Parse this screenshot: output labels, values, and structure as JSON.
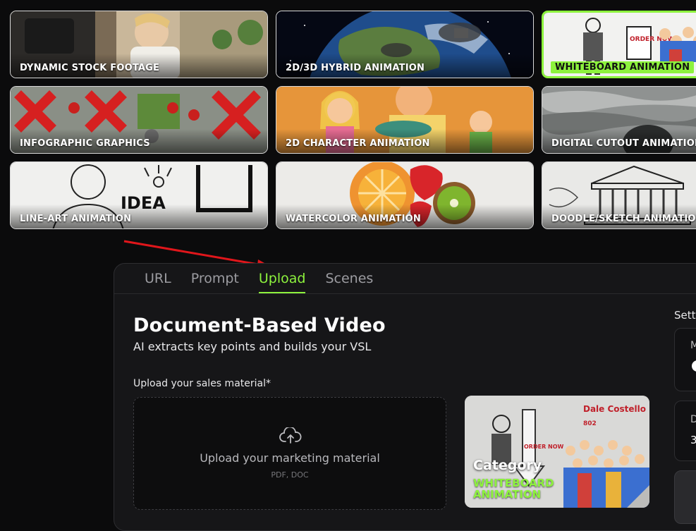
{
  "styles": [
    {
      "label": "DYNAMIC STOCK FOOTAGE",
      "selected": false
    },
    {
      "label": "2D/3D HYBRID ANIMATION",
      "selected": false
    },
    {
      "label": "WHITEBOARD ANIMATION",
      "selected": true
    },
    {
      "label": "INFOGRAPHIC GRAPHICS",
      "selected": false
    },
    {
      "label": "2D CHARACTER ANIMATION",
      "selected": false
    },
    {
      "label": "DIGITAL CUTOUT ANIMATION",
      "selected": false
    },
    {
      "label": "LINE-ART ANIMATION",
      "selected": false
    },
    {
      "label": "WATERCOLOR ANIMATION",
      "selected": false
    },
    {
      "label": "DOODLE/SKETCH ANIMATION",
      "selected": false
    }
  ],
  "tile_art": {
    "whiteboard_sign": "ORDER NOW",
    "lineart_word": "IDEA"
  },
  "tabs": [
    {
      "label": "URL",
      "active": false
    },
    {
      "label": "Prompt",
      "active": false
    },
    {
      "label": "Upload",
      "active": true
    },
    {
      "label": "Scenes",
      "active": false
    }
  ],
  "main": {
    "title": "Document-Based Video",
    "subtitle": "AI extracts key points and builds your VSL",
    "upload_label": "Upload your sales material*",
    "dropzone_text": "Upload your marketing material",
    "dropzone_hint": "PDF, DOC",
    "category_heading": "Category",
    "category_value": "WHITEBOARD ANIMATION",
    "category_art_name": "Dale Costello",
    "category_art_number": "802",
    "category_art_sign": "ORDER NOW"
  },
  "settings": {
    "label": "Setti",
    "box1_letter": "M",
    "box2_letter": "D",
    "box2_value": "3"
  },
  "colors": {
    "accent": "#8df23d",
    "panel": "#161618",
    "background": "#0b0b0c",
    "arrow": "#e0161b"
  },
  "icons": [
    "cloud-upload-icon"
  ]
}
